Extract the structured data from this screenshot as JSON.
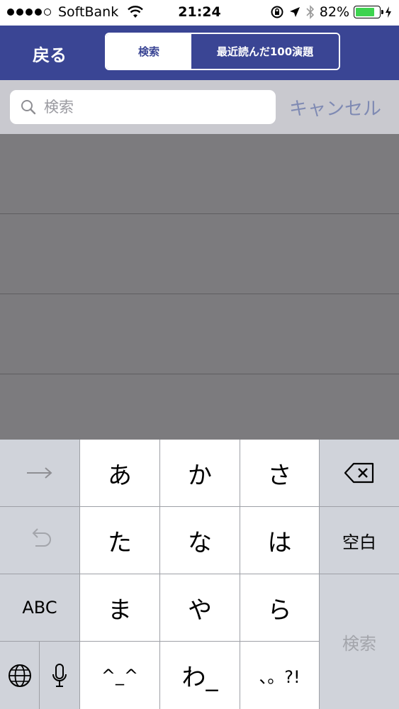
{
  "status_bar": {
    "carrier": "SoftBank",
    "time": "21:24",
    "battery_percent": "82%",
    "battery_level": 0.82
  },
  "nav": {
    "back_label": "戻る",
    "segments": [
      "検索",
      "最近読んだ100演題"
    ]
  },
  "search": {
    "placeholder": "検索",
    "value": "",
    "cancel_label": "キャンセル"
  },
  "keyboard": {
    "row1": [
      "あ",
      "か",
      "さ"
    ],
    "row2": [
      "た",
      "な",
      "は"
    ],
    "row3": [
      "ま",
      "や",
      "ら"
    ],
    "row4": [
      "^_^",
      "わ_",
      "、。?!"
    ],
    "abc_label": "ABC",
    "space_label": "空白",
    "search_label": "検索"
  },
  "colors": {
    "nav_bg": "#3a4594",
    "cancel": "#7f8ab3",
    "battery": "#3dd34f"
  }
}
